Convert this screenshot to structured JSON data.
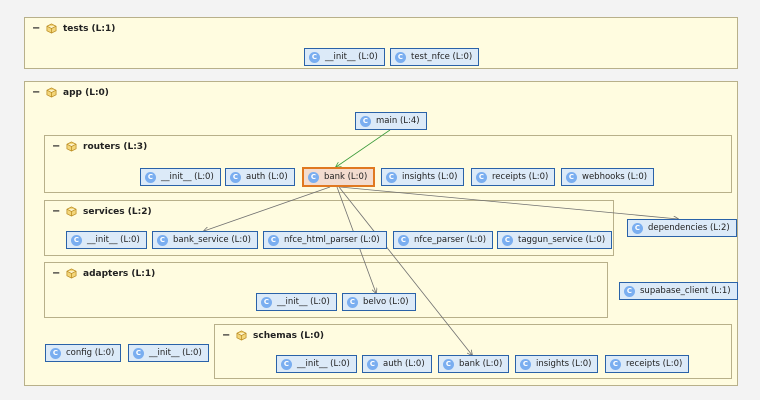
{
  "packages": {
    "tests": "tests (L:1)",
    "app": "app (L:0)",
    "routers": "routers (L:3)",
    "services": "services (L:2)",
    "adapters": "adapters (L:1)",
    "schemas": "schemas (L:0)"
  },
  "modules": {
    "tests_init": "__init__ (L:0)",
    "test_nfce": "test_nfce (L:0)",
    "main": "main (L:4)",
    "routers_init": "__init__ (L:0)",
    "routers_auth": "auth (L:0)",
    "routers_bank": "bank (L:0)",
    "routers_insights": "insights (L:0)",
    "routers_receipts": "receipts (L:0)",
    "routers_webhooks": "webhooks (L:0)",
    "services_init": "__init__ (L:0)",
    "bank_service": "bank_service (L:0)",
    "nfce_html_parser": "nfce_html_parser (L:0)",
    "nfce_parser": "nfce_parser (L:0)",
    "taggun_service": "taggun_service (L:0)",
    "dependencies": "dependencies (L:2)",
    "adapters_init": "__init__ (L:0)",
    "belvo": "belvo (L:0)",
    "supabase_client": "supabase_client (L:1)",
    "config": "config (L:0)",
    "app_init": "__init__ (L:0)",
    "schemas_init": "__init__ (L:0)",
    "schemas_auth": "auth (L:0)",
    "schemas_bank": "bank (L:0)",
    "schemas_insights": "insights (L:0)",
    "schemas_receipts": "receipts (L:0)"
  },
  "icons": {
    "package": "package-icon",
    "module": "class-icon",
    "module_letter": "C"
  },
  "colors": {
    "package_bg": "#fffce0",
    "module_bg": "#dceaf8",
    "module_border": "#2a62a8",
    "selected_border": "#e07820",
    "edge_main": "#3a9a3a",
    "edge_dep": "#707070"
  }
}
